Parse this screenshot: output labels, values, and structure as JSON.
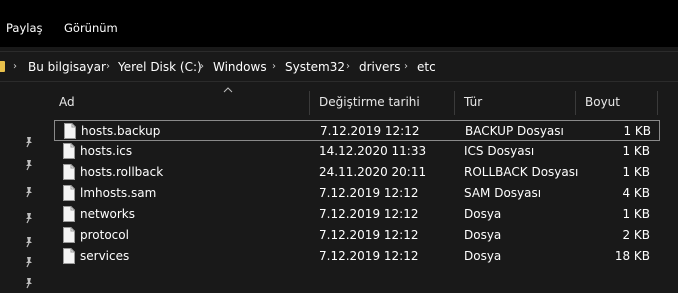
{
  "ribbon": {
    "tabs": [
      "Paylaş",
      "Görünüm"
    ]
  },
  "address": {
    "crumbs": [
      "Bu bilgisayar",
      "Yerel Disk (C:)",
      "Windows",
      "System32",
      "drivers",
      "etc"
    ]
  },
  "columns": {
    "name": "Ad",
    "modified": "Değiştirme tarihi",
    "type": "Tür",
    "size": "Boyut"
  },
  "files": [
    {
      "name": "hosts.backup",
      "modified": "7.12.2019 12:12",
      "type": "BACKUP Dosyası",
      "size": "1 KB"
    },
    {
      "name": "hosts.ics",
      "modified": "14.12.2020 11:33",
      "type": "ICS Dosyası",
      "size": "1 KB"
    },
    {
      "name": "hosts.rollback",
      "modified": "24.11.2020 20:11",
      "type": "ROLLBACK Dosyası",
      "size": "1 KB"
    },
    {
      "name": "lmhosts.sam",
      "modified": "7.12.2019 12:12",
      "type": "SAM Dosyası",
      "size": "4 KB"
    },
    {
      "name": "networks",
      "modified": "7.12.2019 12:12",
      "type": "Dosya",
      "size": "1 KB"
    },
    {
      "name": "protocol",
      "modified": "7.12.2019 12:12",
      "type": "Dosya",
      "size": "2 KB"
    },
    {
      "name": "services",
      "modified": "7.12.2019 12:12",
      "type": "Dosya",
      "size": "18 KB"
    }
  ],
  "selected_index": 0,
  "icons": {
    "pin": "pin-icon",
    "file": "file-icon",
    "folder": "folder-icon",
    "chevron": "chevron-right-icon",
    "sort": "sort-up-icon"
  }
}
